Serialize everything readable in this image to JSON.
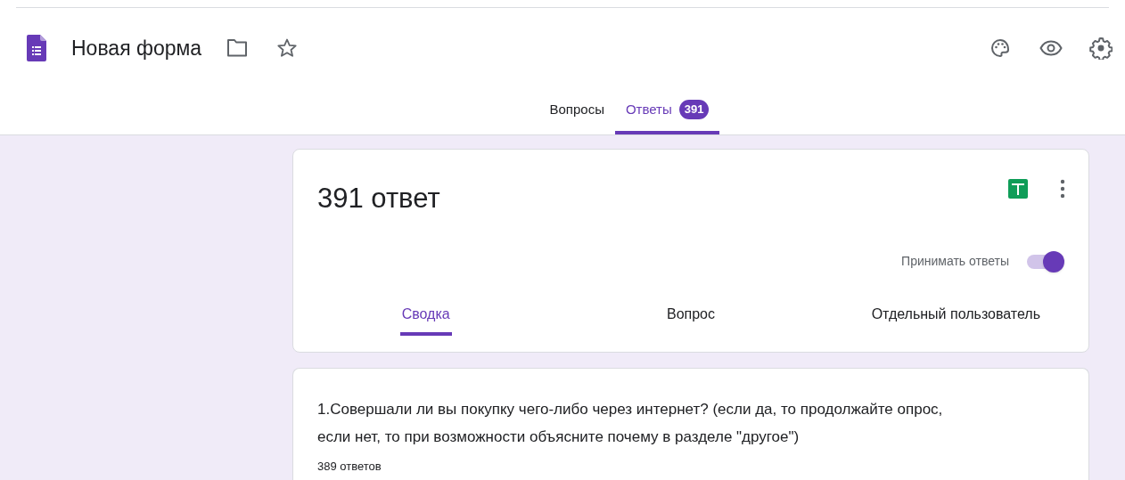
{
  "header": {
    "title": "Новая форма"
  },
  "tabs": [
    {
      "label": "Вопросы",
      "selected": false
    },
    {
      "label": "Ответы",
      "selected": true,
      "badge": "391"
    }
  ],
  "summary_card": {
    "title": "391 ответ",
    "accept_label": "Принимать ответы",
    "accept_on": true,
    "subtabs": [
      {
        "label": "Сводка",
        "selected": true
      },
      {
        "label": "Вопрос",
        "selected": false
      },
      {
        "label": "Отдельный пользователь",
        "selected": false
      }
    ]
  },
  "question_card": {
    "question": "1.Совершали ли вы покупку чего-либо через интернет? (если да, то продолжайте опрос, если нет, то при возможности объясните почему в разделе \"другое\")",
    "count": "389 ответов"
  }
}
